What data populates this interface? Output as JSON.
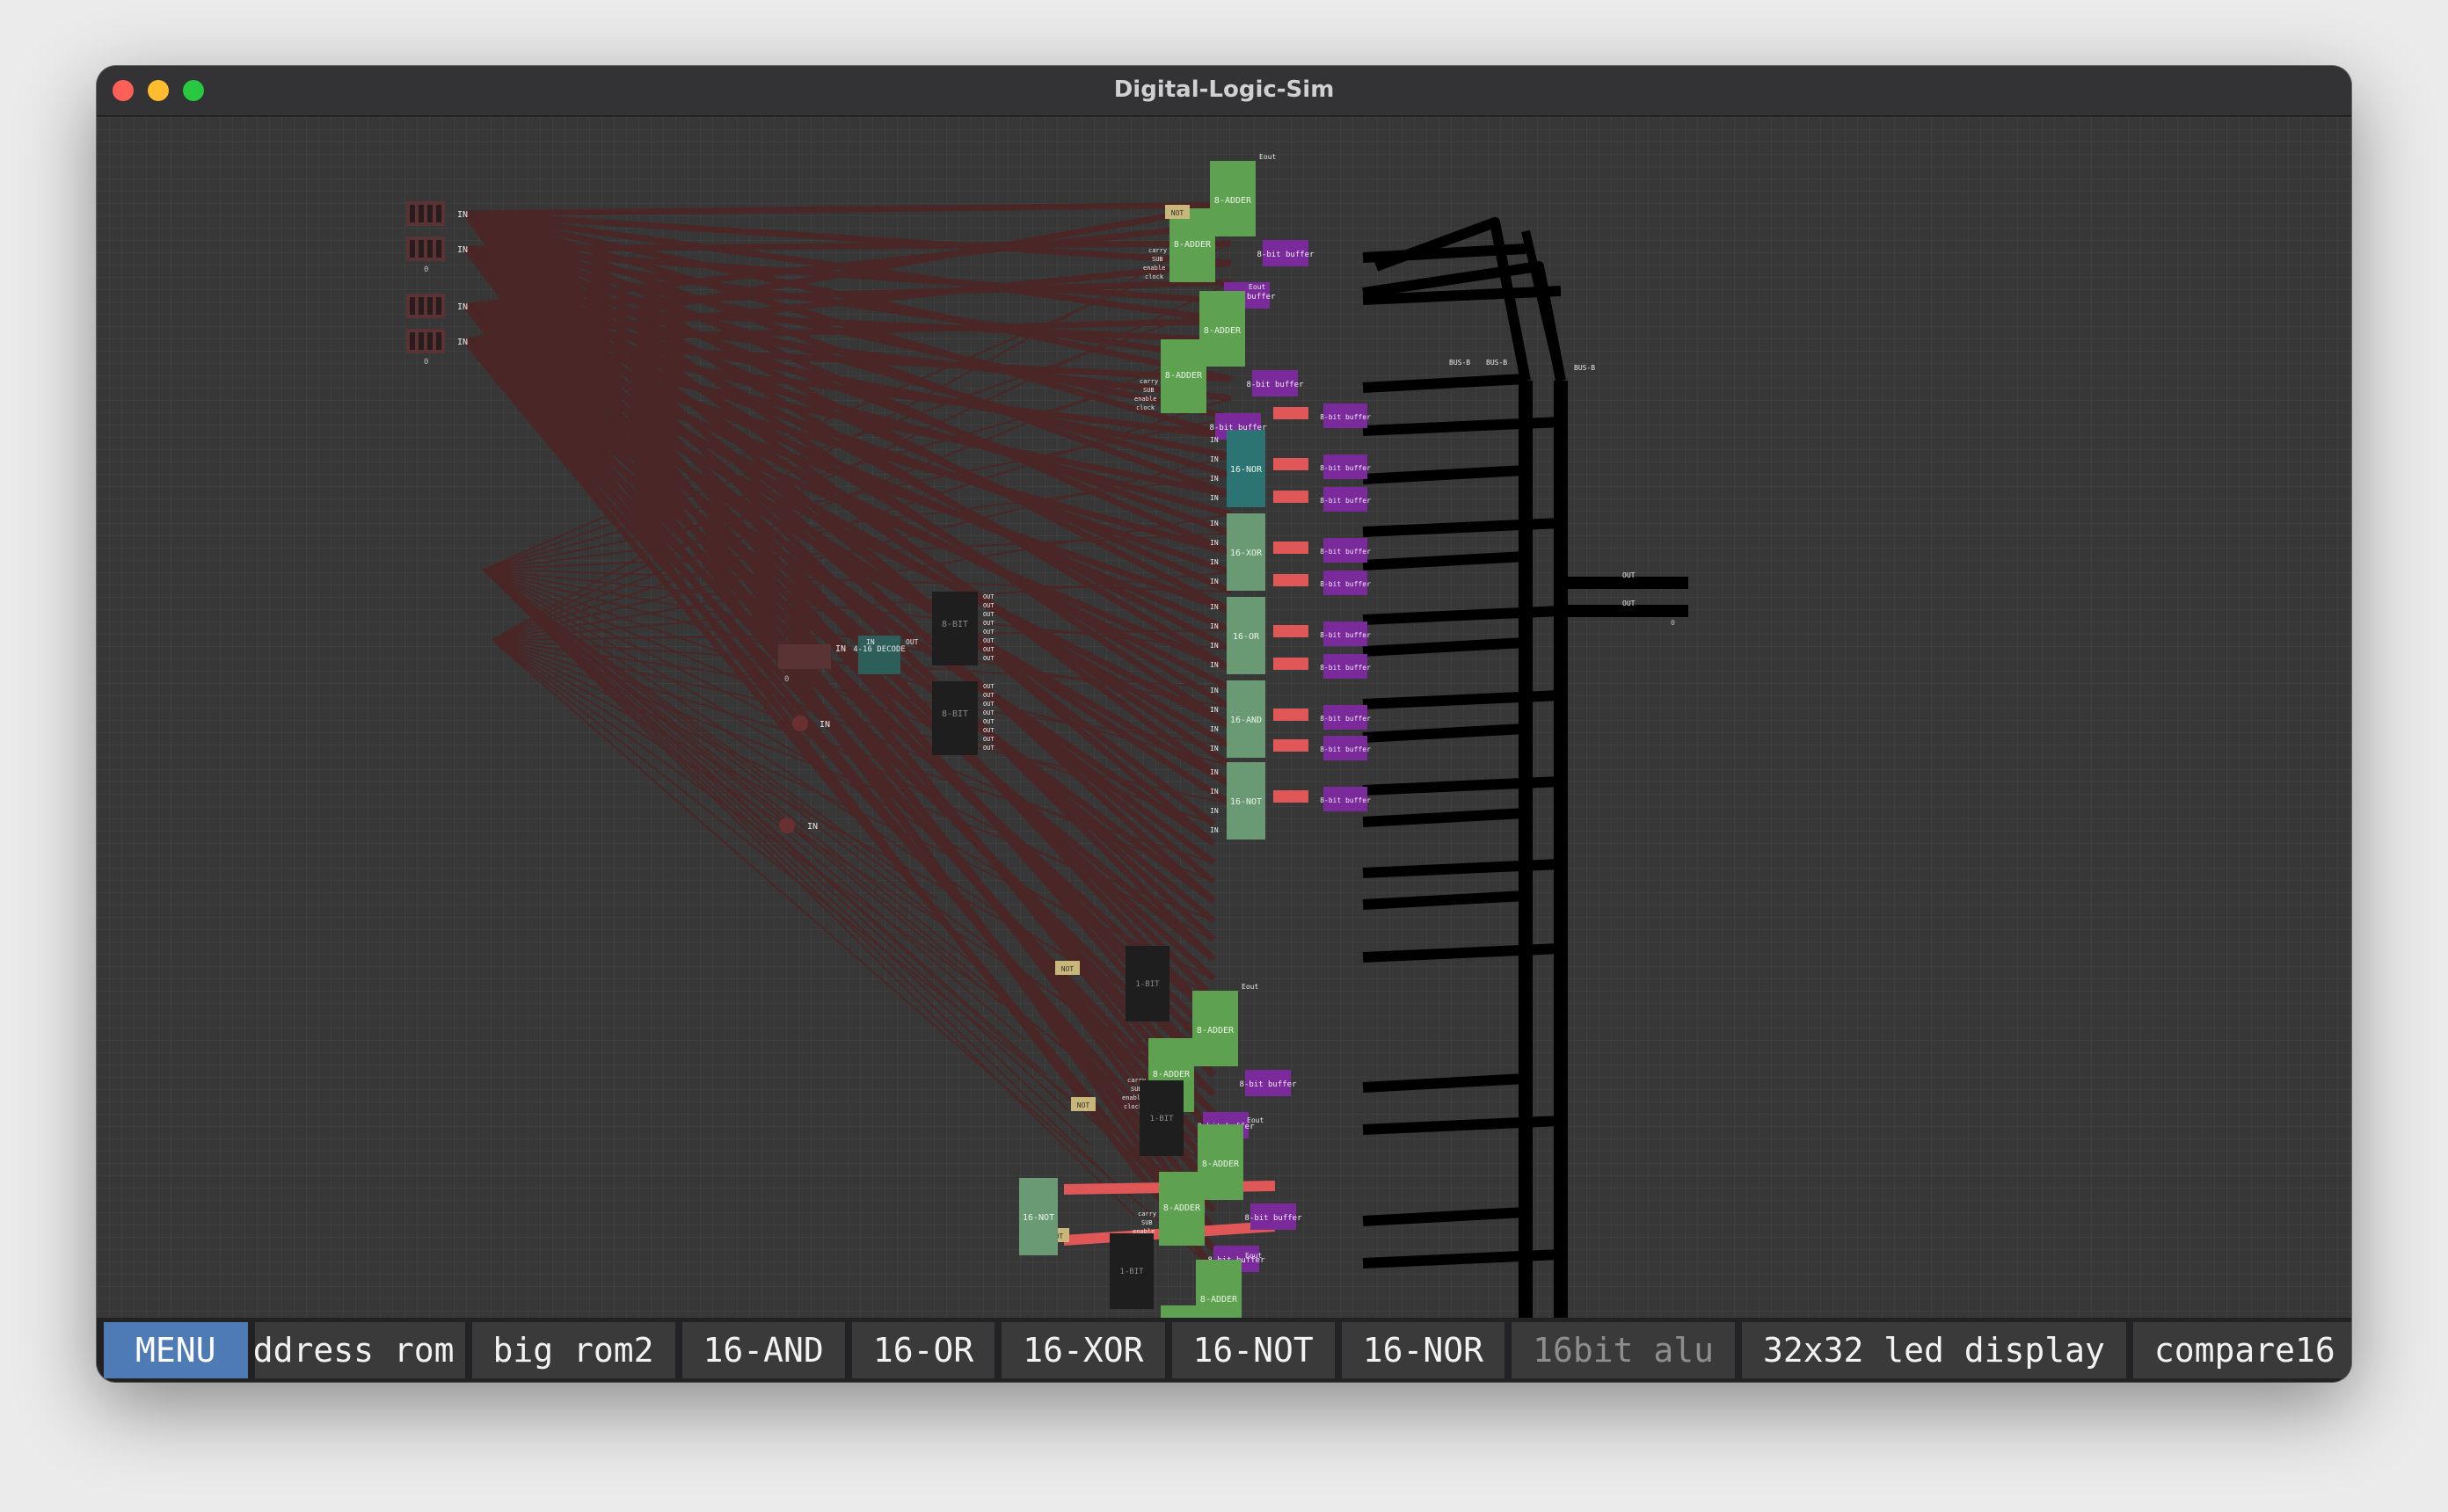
{
  "window": {
    "title": "Digital-Logic-Sim"
  },
  "chip_bar": {
    "menu_label": "MENU",
    "chips": [
      {
        "label": "ddress rom",
        "state": "clipped"
      },
      {
        "label": "big rom2",
        "state": "normal"
      },
      {
        "label": "16-AND",
        "state": "normal"
      },
      {
        "label": "16-OR",
        "state": "normal"
      },
      {
        "label": "16-XOR",
        "state": "normal"
      },
      {
        "label": "16-NOT",
        "state": "normal"
      },
      {
        "label": "16-NOR",
        "state": "normal"
      },
      {
        "label": "16bit alu",
        "state": "disabled"
      },
      {
        "label": "32x32 led display",
        "state": "normal"
      },
      {
        "label": "compare16",
        "state": "normal"
      }
    ]
  },
  "colors": {
    "canvas": "#373737",
    "wire_off": "#4a2626",
    "wire_on": "#e05757",
    "bus": "#000000",
    "adder": "#5ea150",
    "logic16": "#6a9a74",
    "nor16": "#2c7474",
    "decoder": "#2e5e5a",
    "register": "#1e1e1e",
    "buffer": "#7a2a9a",
    "not_gate": "#c8b67a",
    "menu": "#4e7bb5"
  },
  "circuit": {
    "labels": {
      "in": "IN",
      "out": "OUT",
      "not": "NOT",
      "adder": "8-ADDER",
      "buffer": "8-bit buffer",
      "nor": "16-NOR",
      "xor": "16-XOR",
      "or": "16-OR",
      "and": "16-AND",
      "not16": "16-NOT",
      "decode": "4-16 DECODE",
      "reg8": "8-BIT",
      "reg1": "1-BIT",
      "bus": "BUS-B",
      "eout": "Eout",
      "carry": "carry",
      "sub": "SUB",
      "enable": "enable",
      "clock": "clock",
      "zero": "0"
    }
  }
}
